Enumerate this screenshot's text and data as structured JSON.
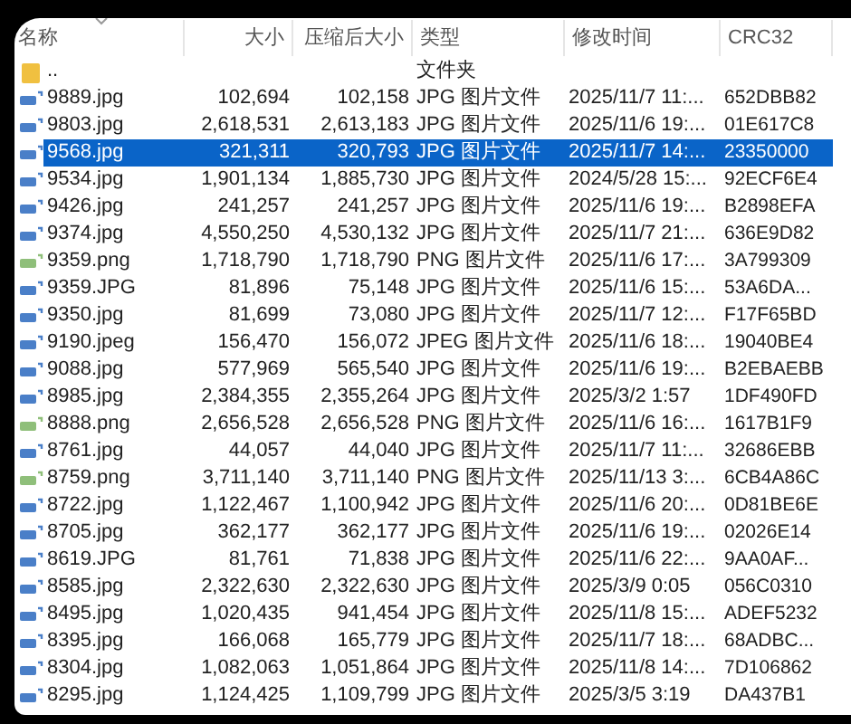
{
  "columns": [
    "名称",
    "大小",
    "压缩后大小",
    "类型",
    "修改时间",
    "CRC32"
  ],
  "rows": [
    {
      "kind": "folder",
      "name": "..",
      "size": "",
      "packed": "",
      "type": "文件夹",
      "modified": "",
      "crc": "",
      "selected": false
    },
    {
      "kind": "jpg",
      "name": "9889.jpg",
      "size": "102,694",
      "packed": "102,158",
      "type": "JPG 图片文件",
      "modified": "2025/11/7 11:...",
      "crc": "652DBB82",
      "selected": false
    },
    {
      "kind": "jpg",
      "name": "9803.jpg",
      "size": "2,618,531",
      "packed": "2,613,183",
      "type": "JPG 图片文件",
      "modified": "2025/11/6 19:...",
      "crc": "01E617C8",
      "selected": false
    },
    {
      "kind": "jpg",
      "name": "9568.jpg",
      "size": "321,311",
      "packed": "320,793",
      "type": "JPG 图片文件",
      "modified": "2025/11/7 14:...",
      "crc": "23350000",
      "selected": true
    },
    {
      "kind": "jpg",
      "name": "9534.jpg",
      "size": "1,901,134",
      "packed": "1,885,730",
      "type": "JPG 图片文件",
      "modified": "2024/5/28 15:...",
      "crc": "92ECF6E4",
      "selected": false
    },
    {
      "kind": "jpg",
      "name": "9426.jpg",
      "size": "241,257",
      "packed": "241,257",
      "type": "JPG 图片文件",
      "modified": "2025/11/6 19:...",
      "crc": "B2898EFA",
      "selected": false
    },
    {
      "kind": "jpg",
      "name": "9374.jpg",
      "size": "4,550,250",
      "packed": "4,530,132",
      "type": "JPG 图片文件",
      "modified": "2025/11/7 21:...",
      "crc": "636E9D82",
      "selected": false
    },
    {
      "kind": "png",
      "name": "9359.png",
      "size": "1,718,790",
      "packed": "1,718,790",
      "type": "PNG 图片文件",
      "modified": "2025/11/6 17:...",
      "crc": "3A799309",
      "selected": false
    },
    {
      "kind": "jpg",
      "name": "9359.JPG",
      "size": "81,896",
      "packed": "75,148",
      "type": "JPG 图片文件",
      "modified": "2025/11/6 15:...",
      "crc": "53A6DA...",
      "selected": false
    },
    {
      "kind": "jpg",
      "name": "9350.jpg",
      "size": "81,699",
      "packed": "73,080",
      "type": "JPG 图片文件",
      "modified": "2025/11/7 12:...",
      "crc": "F17F65BD",
      "selected": false
    },
    {
      "kind": "jpg",
      "name": "9190.jpeg",
      "size": "156,470",
      "packed": "156,072",
      "type": "JPEG 图片文件",
      "modified": "2025/11/6 18:...",
      "crc": "19040BE4",
      "selected": false
    },
    {
      "kind": "jpg",
      "name": "9088.jpg",
      "size": "577,969",
      "packed": "565,540",
      "type": "JPG 图片文件",
      "modified": "2025/11/6 19:...",
      "crc": "B2EBAEBB",
      "selected": false
    },
    {
      "kind": "jpg",
      "name": "8985.jpg",
      "size": "2,384,355",
      "packed": "2,355,264",
      "type": "JPG 图片文件",
      "modified": "2025/3/2 1:57",
      "crc": "1DF490FD",
      "selected": false
    },
    {
      "kind": "png",
      "name": "8888.png",
      "size": "2,656,528",
      "packed": "2,656,528",
      "type": "PNG 图片文件",
      "modified": "2025/11/6 16:...",
      "crc": "1617B1F9",
      "selected": false
    },
    {
      "kind": "jpg",
      "name": "8761.jpg",
      "size": "44,057",
      "packed": "44,040",
      "type": "JPG 图片文件",
      "modified": "2025/11/7 11:...",
      "crc": "32686EBB",
      "selected": false
    },
    {
      "kind": "png",
      "name": "8759.png",
      "size": "3,711,140",
      "packed": "3,711,140",
      "type": "PNG 图片文件",
      "modified": "2025/11/13 3:...",
      "crc": "6CB4A86C",
      "selected": false
    },
    {
      "kind": "jpg",
      "name": "8722.jpg",
      "size": "1,122,467",
      "packed": "1,100,942",
      "type": "JPG 图片文件",
      "modified": "2025/11/6 20:...",
      "crc": "0D81BE6E",
      "selected": false
    },
    {
      "kind": "jpg",
      "name": "8705.jpg",
      "size": "362,177",
      "packed": "362,177",
      "type": "JPG 图片文件",
      "modified": "2025/11/6 19:...",
      "crc": "02026E14",
      "selected": false
    },
    {
      "kind": "jpg",
      "name": "8619.JPG",
      "size": "81,761",
      "packed": "71,838",
      "type": "JPG 图片文件",
      "modified": "2025/11/6 22:...",
      "crc": "9AA0AF...",
      "selected": false
    },
    {
      "kind": "jpg",
      "name": "8585.jpg",
      "size": "2,322,630",
      "packed": "2,322,630",
      "type": "JPG 图片文件",
      "modified": "2025/3/9 0:05",
      "crc": "056C0310",
      "selected": false
    },
    {
      "kind": "jpg",
      "name": "8495.jpg",
      "size": "1,020,435",
      "packed": "941,454",
      "type": "JPG 图片文件",
      "modified": "2025/11/8 15:...",
      "crc": "ADEF5232",
      "selected": false
    },
    {
      "kind": "jpg",
      "name": "8395.jpg",
      "size": "166,068",
      "packed": "165,779",
      "type": "JPG 图片文件",
      "modified": "2025/11/7 18:...",
      "crc": "68ADBC...",
      "selected": false
    },
    {
      "kind": "jpg",
      "name": "8304.jpg",
      "size": "1,082,063",
      "packed": "1,051,864",
      "type": "JPG 图片文件",
      "modified": "2025/11/8 14:...",
      "crc": "7D106862",
      "selected": false
    },
    {
      "kind": "jpg",
      "name": "8295.jpg",
      "size": "1,124,425",
      "packed": "1,109,799",
      "type": "JPG 图片文件",
      "modified": "2025/3/5 3:19",
      "crc": "DA437B1",
      "selected": false
    }
  ]
}
